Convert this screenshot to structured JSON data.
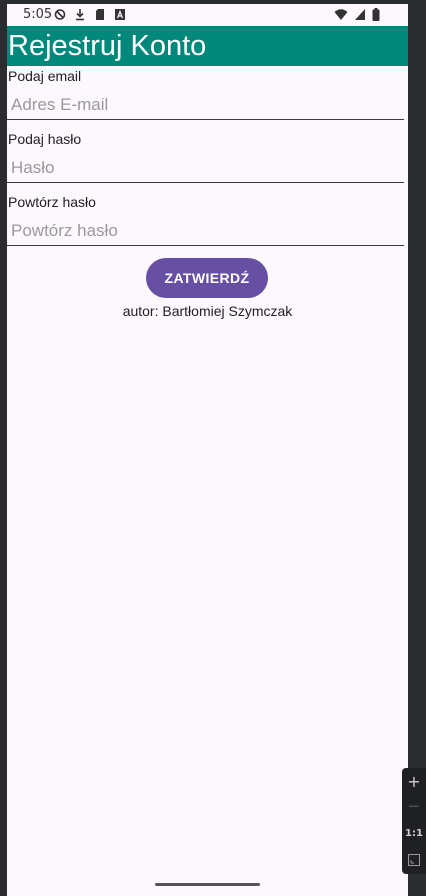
{
  "status_bar": {
    "time": "5:05",
    "left_icons": [
      "do-not-disturb-icon",
      "download-icon",
      "sd-card-icon",
      "text-a-icon"
    ],
    "right_icons": [
      "wifi-icon",
      "signal-icon",
      "battery-icon"
    ]
  },
  "app_bar": {
    "title": "Rejestruj Konto",
    "color": "#00897b"
  },
  "form": {
    "email": {
      "label": "Podaj email",
      "placeholder": "Adres E-mail",
      "value": ""
    },
    "password": {
      "label": "Podaj hasło",
      "placeholder": "Hasło",
      "value": ""
    },
    "password_repeat": {
      "label": "Powtórz hasło",
      "placeholder": "Powtórz hasło",
      "value": ""
    },
    "submit_label": "ZATWIERDŹ",
    "submit_color": "#6750a4"
  },
  "footer": {
    "author": "autor: Bartłomiej Szymczak"
  },
  "zoom_panel": {
    "zoom_in": "+",
    "zoom_out": "—",
    "ratio": "1:1"
  },
  "colors": {
    "background": "#fdf7fe",
    "frame": "#2b2c2f"
  }
}
